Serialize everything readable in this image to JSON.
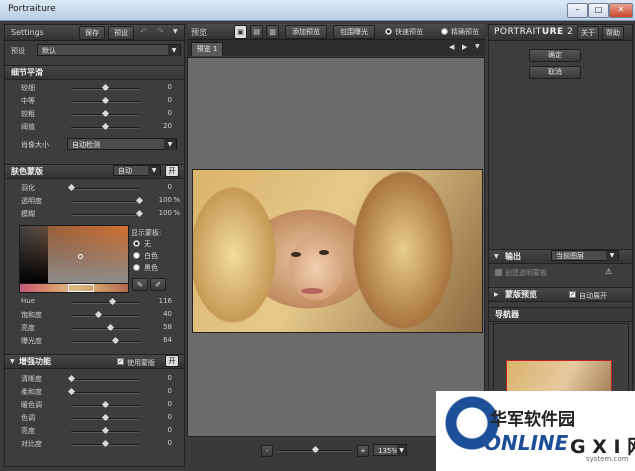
{
  "window": {
    "title": "Portraiture"
  },
  "left": {
    "settings_label": "Settings",
    "save_label": "保存",
    "preset_btn_label": "预设",
    "preset_label": "预设",
    "preset_value": "默认",
    "detail": {
      "title": "细节平滑",
      "sliders": [
        {
          "label": "较细",
          "value": 0,
          "level": 0.5
        },
        {
          "label": "中等",
          "value": 0,
          "level": 0.5
        },
        {
          "label": "较粗",
          "value": 0,
          "level": 0.5
        },
        {
          "label": "阈值",
          "value": 20,
          "level": 0.5
        }
      ],
      "portrait_size_label": "肖像大小",
      "portrait_size_value": "自动检测"
    },
    "skin": {
      "title": "肤色蒙版",
      "mode_value": "自动",
      "toggle_label": "开",
      "sliders": [
        {
          "label": "羽化",
          "value": "0",
          "unit": "",
          "level": 0.0
        },
        {
          "label": "透明度",
          "value": "100",
          "unit": "%",
          "level": 1.0
        },
        {
          "label": "模糊",
          "value": "100",
          "unit": "%",
          "level": 1.0
        }
      ],
      "show_mask_label": "显示蒙板:",
      "mask_options": [
        "无",
        "白色",
        "黑色"
      ],
      "hsl_sliders": [
        {
          "label": "Hue",
          "value": "116",
          "level": 0.6
        },
        {
          "label": "饱和度",
          "value": "40",
          "level": 0.4
        },
        {
          "label": "亮度",
          "value": "58",
          "level": 0.58
        },
        {
          "label": "曝光度",
          "value": "64",
          "level": 0.64
        }
      ]
    },
    "enhance": {
      "title": "增强功能",
      "use_mask_label": "使用蒙版",
      "toggle_label": "开",
      "sliders": [
        {
          "label": "清晰度",
          "value": 0,
          "level": 0.0
        },
        {
          "label": "柔和度",
          "value": 0,
          "level": 0.0
        },
        {
          "label": "暖色调",
          "value": 0,
          "level": 0.5
        },
        {
          "label": "色调",
          "value": 0,
          "level": 0.5
        },
        {
          "label": "亮度",
          "value": 0,
          "level": 0.5
        },
        {
          "label": "对比度",
          "value": 0,
          "level": 0.5
        }
      ]
    }
  },
  "center": {
    "preview_label": "预览",
    "add_preview_label": "添加预览",
    "exposure_label": "包围曝光",
    "fast_preview_label": "快速预览",
    "precise_preview_label": "精确预览",
    "tab_label": "预览 1",
    "zoom_value": "135%"
  },
  "right": {
    "brand_prefix": "PORTRAIT",
    "brand_bold": "URE",
    "brand_version": "2",
    "about_label": "关于",
    "help_label": "帮助",
    "ok_label": "确定",
    "cancel_label": "取消",
    "output_label": "输出",
    "output_value": "当前图层",
    "create_mask_label": "创建透明蒙板",
    "mask_preview_label": "蒙版预览",
    "auto_expand_label": "自动展开",
    "navigator_label": "导航器"
  },
  "watermark": {
    "cn": "华军软件园",
    "brand": "ONLINE",
    "site": "G X I 网",
    "domain": "system.com"
  }
}
